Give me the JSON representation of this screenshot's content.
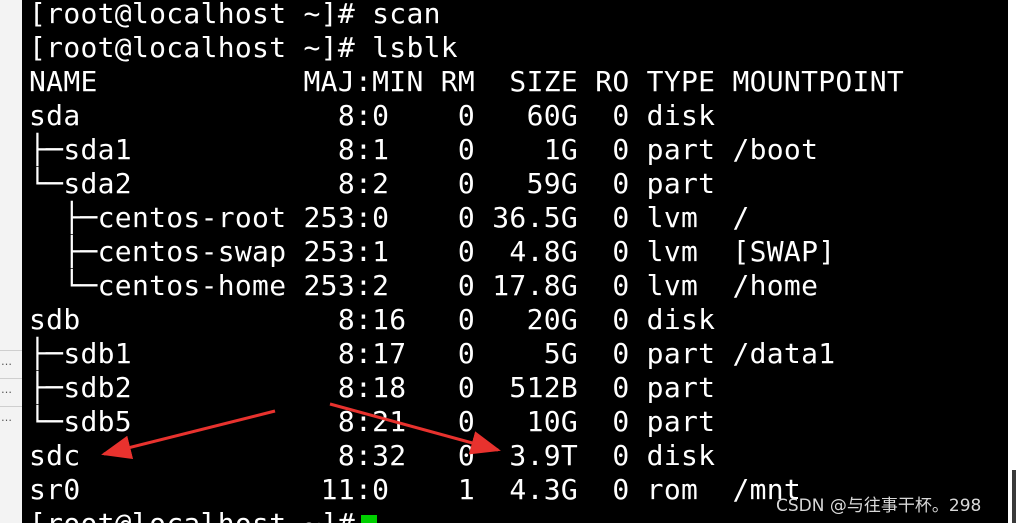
{
  "terminal": {
    "lines": [
      "[root@localhost ~]# scan",
      "[root@localhost ~]# lsblk",
      "NAME            MAJ:MIN RM  SIZE RO TYPE MOUNTPOINT",
      "sda               8:0    0   60G  0 disk",
      "├─sda1            8:1    0    1G  0 part /boot",
      "└─sda2            8:2    0   59G  0 part",
      "  ├─centos-root 253:0    0 36.5G  0 lvm  /",
      "  ├─centos-swap 253:1    0  4.8G  0 lvm  [SWAP]",
      "  └─centos-home 253:2    0 17.8G  0 lvm  /home",
      "sdb               8:16   0   20G  0 disk",
      "├─sdb1            8:17   0    5G  0 part /data1",
      "├─sdb2            8:18   0  512B  0 part",
      "└─sdb5            8:21   0   10G  0 part",
      "sdc               8:32   0  3.9T  0 disk",
      "sr0              11:0    1  4.3G  0 rom  /mnt"
    ],
    "prompt_line": "[root@localhost ~]#"
  },
  "side_panel": {
    "marks": [
      "…",
      "…",
      "…"
    ]
  },
  "watermark": "CSDN @与往事干杯。298",
  "colors": {
    "terminal_bg": "#000000",
    "text": "#ffffff",
    "cursor": "#00d000",
    "arrow": "#e8322e"
  }
}
